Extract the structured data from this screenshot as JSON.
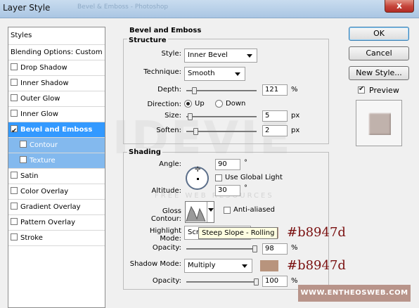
{
  "window": {
    "title": "Layer Style",
    "title_watermark": "Bevel & Emboss - Photoshop",
    "close_label": "x"
  },
  "left_panel": {
    "styles_header": "Styles",
    "blending_options": "Blending Options: Custom",
    "items": [
      {
        "label": "Drop Shadow",
        "checked": false
      },
      {
        "label": "Inner Shadow",
        "checked": false
      },
      {
        "label": "Outer Glow",
        "checked": false
      },
      {
        "label": "Inner Glow",
        "checked": false
      },
      {
        "label": "Bevel and Emboss",
        "checked": true,
        "selected": true
      },
      {
        "label": "Contour",
        "checked": false,
        "sub": true
      },
      {
        "label": "Texture",
        "checked": false,
        "sub": true
      },
      {
        "label": "Satin",
        "checked": false
      },
      {
        "label": "Color Overlay",
        "checked": false
      },
      {
        "label": "Gradient Overlay",
        "checked": false
      },
      {
        "label": "Pattern Overlay",
        "checked": false
      },
      {
        "label": "Stroke",
        "checked": false
      }
    ]
  },
  "bevel": {
    "title": "Bevel and Emboss",
    "structure": {
      "title": "Structure",
      "style_label": "Style:",
      "style_value": "Inner Bevel",
      "technique_label": "Technique:",
      "technique_value": "Smooth",
      "depth_label": "Depth:",
      "depth_value": "121",
      "depth_unit": "%",
      "direction_label": "Direction:",
      "direction_up": "Up",
      "direction_down": "Down",
      "size_label": "Size:",
      "size_value": "5",
      "size_unit": "px",
      "soften_label": "Soften:",
      "soften_value": "2",
      "soften_unit": "px"
    },
    "shading": {
      "title": "Shading",
      "angle_label": "Angle:",
      "angle_value": "90",
      "angle_unit": "°",
      "use_global_light": "Use Global Light",
      "altitude_label": "Altitude:",
      "altitude_value": "30",
      "altitude_unit": "°",
      "gloss_label": "Gloss Contour:",
      "anti_aliased": "Anti-aliased",
      "highlight_label": "Highlight Mode:",
      "highlight_value": "Scr",
      "highlight_opacity_label": "Opacity:",
      "highlight_opacity": "98",
      "highlight_opacity_unit": "%",
      "shadow_label": "Shadow Mode:",
      "shadow_value": "Multiply",
      "shadow_opacity_label": "Opacity:",
      "shadow_opacity": "100",
      "shadow_opacity_unit": "%",
      "tooltip": "Steep Slope - Rolling"
    }
  },
  "annotations": {
    "highlight_color_text": "#b8947d",
    "shadow_color_text": "#b8947d",
    "swatch_color": "#b8947d"
  },
  "buttons": {
    "ok": "OK",
    "cancel": "Cancel",
    "new_style": "New Style...",
    "preview": "Preview"
  },
  "watermark": {
    "big": "IDEVIE",
    "small": "FREE WEB RESOURCES"
  },
  "credit": "WWW.ENTHEOSWEB.COM",
  "colors": {
    "selection": "#3399ff",
    "sub_selection": "#83b9ee",
    "annotation_text": "#7a1010",
    "swatch": "#b8947d",
    "credit_bg": "#b8948a"
  }
}
